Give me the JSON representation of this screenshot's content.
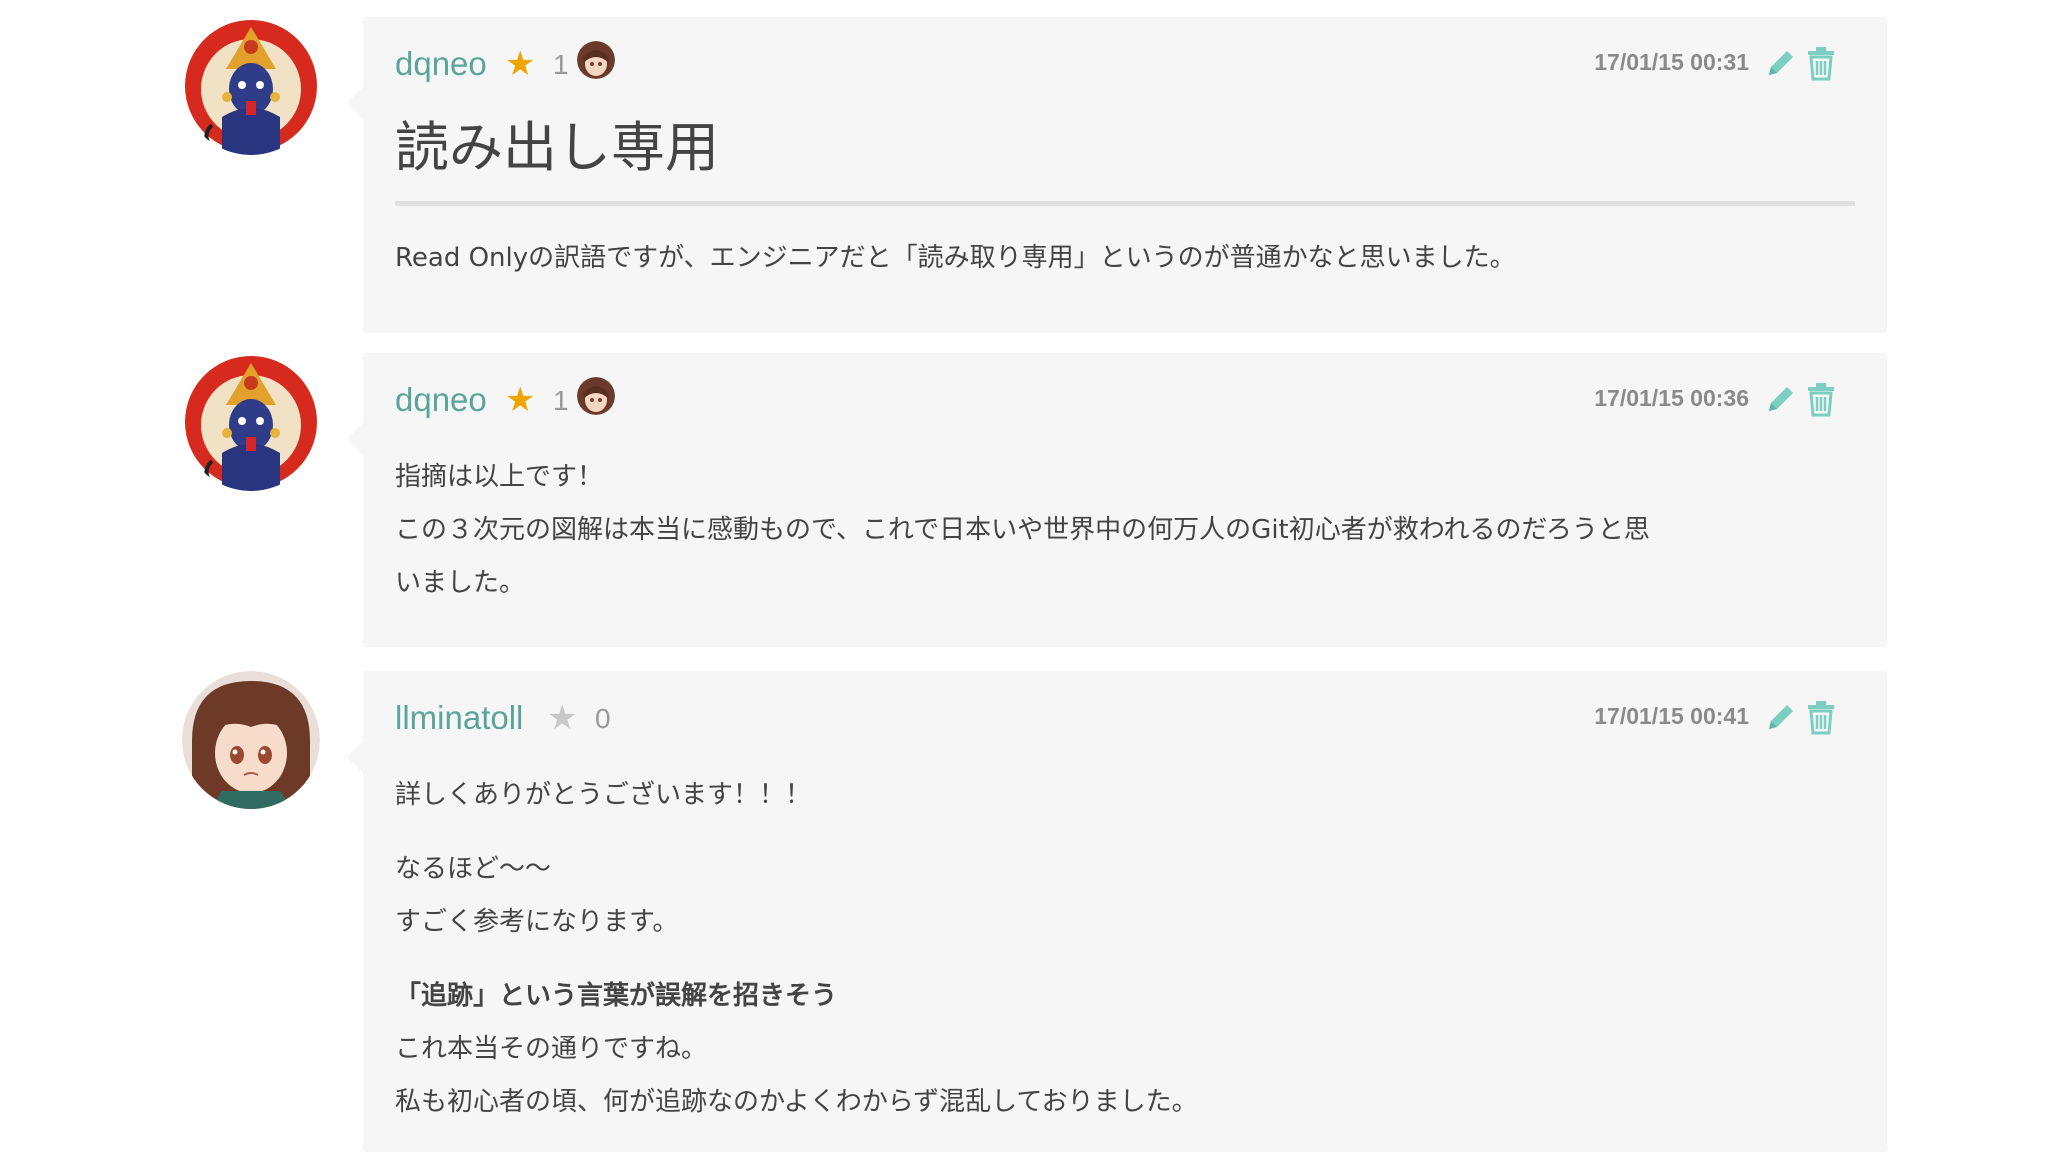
{
  "comments": [
    {
      "username": "dqneo",
      "star_count": "1",
      "starred": true,
      "avatar_icon": "deity-avatar",
      "timestamp": "17/01/15 00:31",
      "heading": "読み出し専用",
      "lines": [
        "Read Onlyの訳語ですが、エンジニアだと「読み取り専用」というのが普通かなと思いました。"
      ]
    },
    {
      "username": "dqneo",
      "star_count": "1",
      "starred": true,
      "avatar_icon": "deity-avatar",
      "timestamp": "17/01/15 00:36",
      "lines": [
        "指摘は以上です！",
        "この３次元の図解は本当に感動もので、これで日本いや世界中の何万人のGit初心者が救われるのだろうと思",
        "いました。"
      ]
    },
    {
      "username": "llminatoll",
      "star_count": "0",
      "starred": false,
      "avatar_icon": "anime-girl-avatar",
      "timestamp": "17/01/15 00:41",
      "paragraphs": [
        [
          "詳しくありがとうございます！！！"
        ],
        [
          "なるほど〜〜",
          "すごく参考になります。"
        ],
        [
          "「追跡」という言葉が誤解を招きそう",
          "これ本当その通りですね。",
          "私も初心者の頃、何が追跡なのかよくわからず混乱しておりました。"
        ]
      ]
    }
  ],
  "colors": {
    "username": "#5aa59a",
    "star_on": "#f0a400",
    "star_off": "#c8c8c8",
    "action_icon": "#7ccfc0",
    "card_bg": "#f6f6f6"
  }
}
